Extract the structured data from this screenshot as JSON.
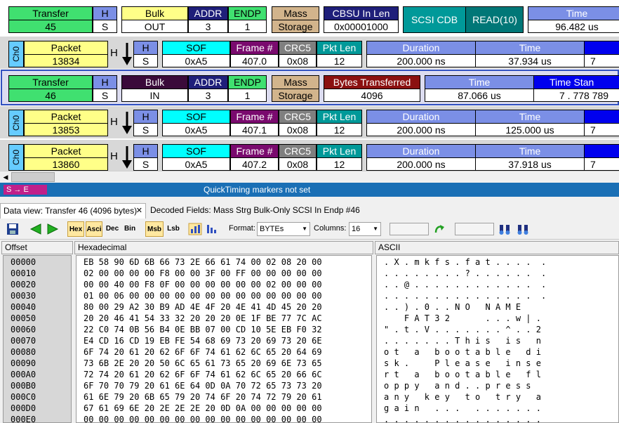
{
  "rows": [
    {
      "kind": "transfer",
      "transfer_label": "Transfer",
      "transfer_value": "45",
      "h_label": "H",
      "h_value": "S",
      "type_label": "Bulk",
      "type_value": "OUT",
      "addr_label": "ADDR",
      "addr_value": "3",
      "endp_label": "ENDP",
      "endp_value": "1",
      "mass_label": "Mass",
      "mass_value": "Storage",
      "cbsu_label": "CBSU In Len",
      "cbsu_value": "0x00001000",
      "cdb_label": "SCSI CDB",
      "cdb_value": "READ(10)",
      "time_label": "Time",
      "time_value": "96.482 us"
    },
    {
      "kind": "packet",
      "ch": "Ch0",
      "packet_label": "Packet",
      "packet_value": "13834",
      "h_letter": "H",
      "h_label": "H",
      "h_value": "S",
      "sof_label": "SOF",
      "sof_value": "0xA5",
      "frame_label": "Frame #",
      "frame_value": "407.0",
      "crc_label": "CRC5",
      "crc_value": "0x08",
      "len_label": "Pkt Len",
      "len_value": "12",
      "dur_label": "Duration",
      "dur_value": "200.000 ns",
      "time_label": "Time",
      "time_value": "37.934 us",
      "tail_value": "7"
    },
    {
      "kind": "transfer2",
      "transfer_label": "Transfer",
      "transfer_value": "46",
      "h_label": "H",
      "h_value": "S",
      "type_label": "Bulk",
      "type_value": "IN",
      "addr_label": "ADDR",
      "addr_value": "3",
      "endp_label": "ENDP",
      "endp_value": "1",
      "mass_label": "Mass",
      "mass_value": "Storage",
      "bytes_label": "Bytes Transferred",
      "bytes_value": "4096",
      "time_label": "Time",
      "time_value": "87.066 us",
      "tstamp_label": "Time Stan",
      "tstamp_value": "7 . 778 789"
    },
    {
      "kind": "packet",
      "ch": "Ch0",
      "packet_label": "Packet",
      "packet_value": "13853",
      "h_letter": "H",
      "h_label": "H",
      "h_value": "S",
      "sof_label": "SOF",
      "sof_value": "0xA5",
      "frame_label": "Frame #",
      "frame_value": "407.1",
      "crc_label": "CRC5",
      "crc_value": "0x08",
      "len_label": "Pkt Len",
      "len_value": "12",
      "dur_label": "Duration",
      "dur_value": "200.000 ns",
      "time_label": "Time",
      "time_value": "125.000 us",
      "tail_value": "7"
    },
    {
      "kind": "packet",
      "ch": "Ch0",
      "packet_label": "Packet",
      "packet_value": "13860",
      "h_letter": "H",
      "h_label": "H",
      "h_value": "S",
      "sof_label": "SOF",
      "sof_value": "0xA5",
      "frame_label": "Frame #",
      "frame_value": "407.2",
      "crc_label": "CRC5",
      "crc_value": "0x08",
      "len_label": "Pkt Len",
      "len_value": "12",
      "dur_label": "Duration",
      "dur_value": "200.000 ns",
      "time_label": "Time",
      "time_value": "37.918 us",
      "tail_value": "7"
    }
  ],
  "status": {
    "markers": "S → E",
    "quicktiming": "QuickTiming markers not set"
  },
  "tabs": [
    {
      "label": "Data view: Transfer 46 (4096 bytes)",
      "close": "✕"
    },
    {
      "label": "Decoded Fields: Mass Strg Bulk-Only SCSI In Endp #46"
    }
  ],
  "toolbar": {
    "hex": "Hex",
    "asci": "Asci",
    "dec": "Dec",
    "bin": "Bin",
    "msb": "Msb",
    "lsb": "Lsb",
    "format_label": "Format:",
    "format_value": "BYTEs",
    "columns_label": "Columns:",
    "columns_value": "16"
  },
  "hexview": {
    "offset_header": "Offset",
    "hex_header": "Hexadecimal",
    "ascii_header": "ASCII",
    "offsets": [
      "00000",
      "00010",
      "00020",
      "00030",
      "00040",
      "00050",
      "00060",
      "00070",
      "00080",
      "00090",
      "000A0",
      "000B0",
      "000C0",
      "000D0",
      "000E0"
    ],
    "hex": [
      "EB 58 90 6D 6B 66 73 2E 66 61 74 00 02 08 20 00",
      "02 00 00 00 00 F8 00 00 3F 00 FF 00 00 00 00 00",
      "00 00 40 00 F8 0F 00 00 00 00 00 00 02 00 00 00",
      "01 00 06 00 00 00 00 00 00 00 00 00 00 00 00 00",
      "80 00 29 A2 30 B9 AD 4E 4F 20 4E 41 4D 45 20 20",
      "20 20 46 41 54 33 32 20 20 20 0E 1F BE 77 7C AC",
      "22 C0 74 0B 56 B4 0E BB 07 00 CD 10 5E EB F0 32",
      "E4 CD 16 CD 19 EB FE 54 68 69 73 20 69 73 20 6E",
      "6F 74 20 61 20 62 6F 6F 74 61 62 6C 65 20 64 69",
      "73 6B 2E 20 20 50 6C 65 61 73 65 20 69 6E 73 65",
      "72 74 20 61 20 62 6F 6F 74 61 62 6C 65 20 66 6C",
      "6F 70 70 79 20 61 6E 64 0D 0A 70 72 65 73 73 20",
      "61 6E 79 20 6B 65 79 20 74 6F 20 74 72 79 20 61",
      "67 61 69 6E 20 2E 2E 2E 20 0D 0A 00 00 00 00 00",
      "00 00 00 00 00 00 00 00 00 00 00 00 00 00 00 00"
    ],
    "ascii": [
      ". X . m k f s . f a t . . . .  .",
      ". . . . . . . . ? . . . . . .  .",
      ". . @ . . . . . . . . . . . .  .",
      ". . . . . . . . . . . . . . .  .",
      ". . ) . 0 . . N O   N A M E",
      "    F A T 3 2       . . . w | .",
      "\" . t . V . . . . . . . ^ . . 2",
      ". . . . . . . T h i s   i s   n",
      "o t   a   b o o t a b l e   d i",
      "s k .     P l e a s e   i n s e",
      "r t   a   b o o t a b l e   f l",
      "o p p y   a n d . . p r e s s",
      "a n y   k e y   t o   t r y   a",
      "g a i n   . . .   . . . . . . .",
      ". . . . . . . . . . . . . . . ."
    ]
  },
  "colors": {
    "green": "#40e070",
    "blue": "#7b8fe6",
    "yellow": "#ffff88",
    "navy": "#1f1f7a",
    "teal": "#009999",
    "mass": "#d2b48c",
    "cyan": "#00ffff",
    "purple": "#7a0a6e",
    "grey": "#7f7f7f",
    "statusbar": "#1a6fb5",
    "darkred": "#8b1010",
    "darkpurple": "#3a0a3a"
  }
}
